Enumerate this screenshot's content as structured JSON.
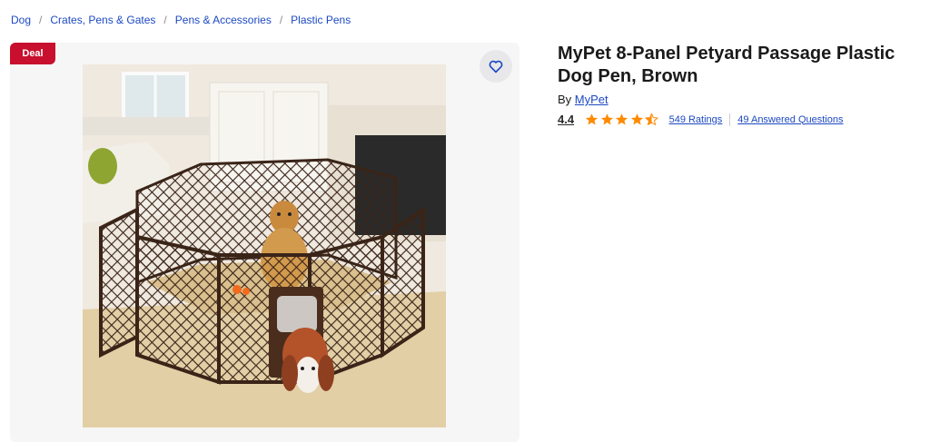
{
  "breadcrumb": {
    "items": [
      "Dog",
      "Crates, Pens & Gates",
      "Pens & Accessories",
      "Plastic Pens"
    ],
    "separator": "/"
  },
  "gallery": {
    "badge": "Deal",
    "favorite_icon": "heart-icon",
    "image_alt": "MyPet 8-panel brown petyard with a golden retriever inside and a spaniel walking through the door"
  },
  "product": {
    "title": "MyPet 8-Panel Petyard Passage Plastic Dog Pen, Brown",
    "by_label": "By",
    "brand": "MyPet",
    "rating": "4.4",
    "rating_value": 4.4,
    "ratings_count_label": "549 Ratings",
    "questions_label": "49 Answered Questions"
  },
  "colors": {
    "link": "#1c49c2",
    "deal_badge": "#c8102e",
    "star": "#ff8a00"
  }
}
